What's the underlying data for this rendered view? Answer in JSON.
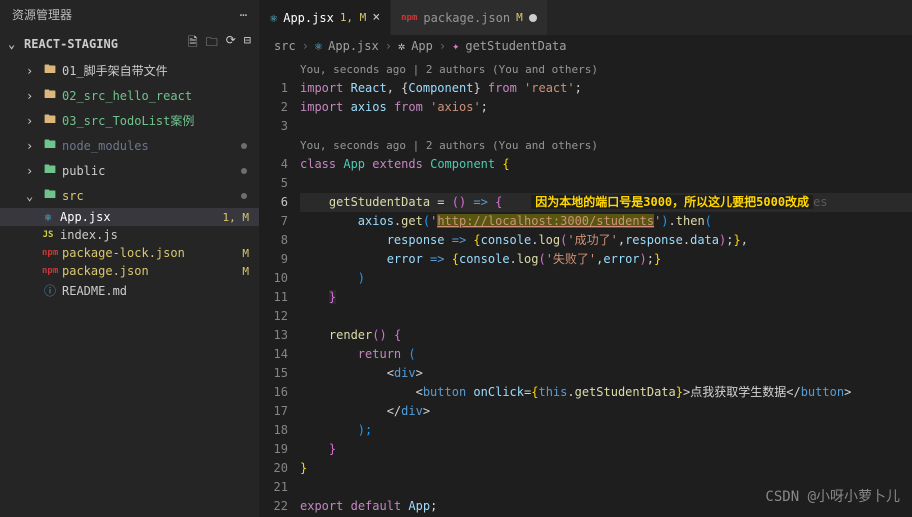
{
  "sidebar": {
    "title": "资源管理器",
    "more": "⋯",
    "project": "REACT-STAGING",
    "items": [
      {
        "icon": ">",
        "type": "folder",
        "name": "01_脚手架自带文件",
        "cls": ""
      },
      {
        "icon": ">",
        "type": "folder",
        "name": "02_src_hello_react",
        "cls": "untracked"
      },
      {
        "icon": ">",
        "type": "folder",
        "name": "03_src_TodoList案例",
        "cls": "untracked"
      },
      {
        "icon": ">",
        "type": "folder-green",
        "name": "node_modules",
        "cls": "muted",
        "dot": true
      },
      {
        "icon": ">",
        "type": "folder-green",
        "name": "public",
        "cls": "",
        "dot": true
      },
      {
        "icon": "v",
        "type": "folder-green",
        "name": "src",
        "cls": "mod",
        "dot": true
      }
    ],
    "srcChildren": [
      {
        "icon": "react",
        "name": "App.jsx",
        "badge": "1, M",
        "sel": true,
        "cls": "mod"
      },
      {
        "icon": "js",
        "name": "index.js",
        "cls": ""
      }
    ],
    "rootFiles": [
      {
        "icon": "npm",
        "name": "package-lock.json",
        "badge": "M",
        "cls": "mod"
      },
      {
        "icon": "npm",
        "name": "package.json",
        "badge": "M",
        "cls": "mod"
      },
      {
        "icon": "md",
        "name": "README.md",
        "cls": ""
      }
    ]
  },
  "tabs": [
    {
      "icon": "react",
      "name": "App.jsx",
      "status": "1, M",
      "close": "×",
      "active": true
    },
    {
      "icon": "npm",
      "name": "package.json",
      "status": "M",
      "close": "dot",
      "active": false
    }
  ],
  "breadcrumb": [
    "src",
    "App.jsx",
    "App",
    "getStudentData"
  ],
  "codelens1": "You, seconds ago | 2 authors (You and others)",
  "codelens2": "You, seconds ago | 2 authors (You and others)",
  "lines": {
    "l1": {
      "a": "import",
      "b": "React",
      "c": ", {",
      "d": "Component",
      "e": "} ",
      "f": "from",
      "g": "'react'",
      "h": ";"
    },
    "l2": {
      "a": "import",
      "b": "axios",
      "c": "from",
      "d": "'axios'",
      "e": ";"
    },
    "l4": {
      "a": "class",
      "b": "App",
      "c": "extends",
      "d": "Component",
      "e": "{"
    },
    "l6": {
      "a": "getStudentData",
      "b": " = ",
      "c": "()",
      "d": " => ",
      "e": "{",
      "annot": "因为本地的端口号是3000，所以这儿要把5000改成",
      "aut": "es"
    },
    "l7": {
      "a": "axios",
      "b": ".",
      "c": "get",
      "d": "(",
      "e": "'",
      "f": "http://localhost:3000/students",
      "g": "'",
      "h": ")",
      "i": ".",
      "j": "then",
      "k": "("
    },
    "l8": {
      "a": "response",
      "b": " => ",
      "c": "{",
      "d": "console",
      "e": ".",
      "f": "log",
      "g": "(",
      "h": "'成功了'",
      "i": ",",
      "j": "response",
      "k": ".",
      "l": "data",
      "m": ")",
      "n": ";",
      "o": "}",
      "p": ","
    },
    "l9": {
      "a": "error",
      "b": " => ",
      "c": "{",
      "d": "console",
      "e": ".",
      "f": "log",
      "g": "(",
      "h": "'失败了'",
      "i": ",",
      "j": "error",
      "k": ")",
      "l": ";",
      "m": "}"
    },
    "l10": {
      "a": ")"
    },
    "l11": {
      "a": "}"
    },
    "l13": {
      "a": "render",
      "b": "()",
      "c": " {"
    },
    "l14": {
      "a": "return",
      "b": " ("
    },
    "l15": {
      "a": "<",
      "b": "div",
      "c": ">"
    },
    "l16": {
      "a": "<",
      "b": "button",
      "c": " ",
      "d": "onClick",
      "e": "=",
      "f": "{",
      "g": "this",
      "h": ".",
      "i": "getStudentData",
      "j": "}",
      "k": ">",
      "l": "点我获取学生数据",
      "m": "</",
      "n": "button",
      "o": ">"
    },
    "l17": {
      "a": "</",
      "b": "div",
      "c": ">"
    },
    "l18": {
      "a": ");"
    },
    "l19": {
      "a": "}"
    },
    "l20": {
      "a": "}"
    },
    "l22": {
      "a": "export",
      "b": "default",
      "c": "App",
      "d": ";"
    }
  },
  "watermark": "CSDN @小呀小萝卜儿"
}
